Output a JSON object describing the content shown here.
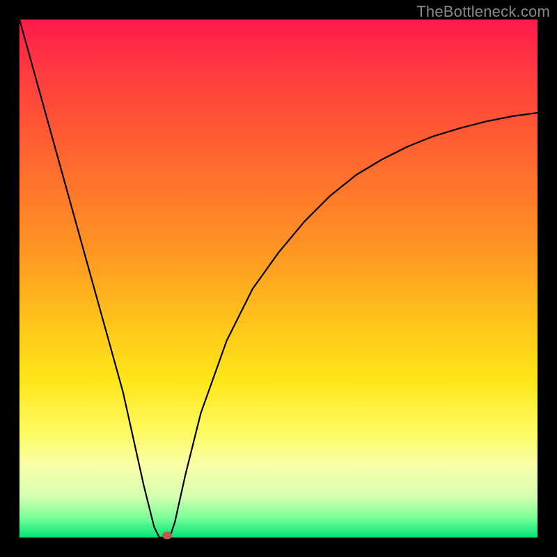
{
  "watermark": "TheBottleneck.com",
  "chart_data": {
    "type": "line",
    "title": "",
    "xlabel": "",
    "ylabel": "",
    "xlim": [
      0,
      100
    ],
    "ylim": [
      0,
      100
    ],
    "grid": false,
    "series": [
      {
        "name": "curve",
        "x": [
          0,
          5,
          10,
          15,
          20,
          24,
          26,
          27,
          28,
          29,
          30,
          32,
          35,
          40,
          45,
          50,
          55,
          60,
          65,
          70,
          75,
          80,
          85,
          90,
          95,
          100
        ],
        "y": [
          100,
          82,
          64,
          46,
          28,
          10,
          2,
          0,
          0,
          0,
          3,
          12,
          24,
          38,
          48,
          55,
          61,
          66,
          70,
          73,
          75.5,
          77.5,
          79,
          80.3,
          81.3,
          82
        ]
      }
    ],
    "annotations": [
      {
        "name": "min-dot",
        "x": 28.5,
        "y": 0
      }
    ],
    "background_gradient": [
      "#ff1a4b",
      "#ffe71a",
      "#00e576"
    ]
  }
}
